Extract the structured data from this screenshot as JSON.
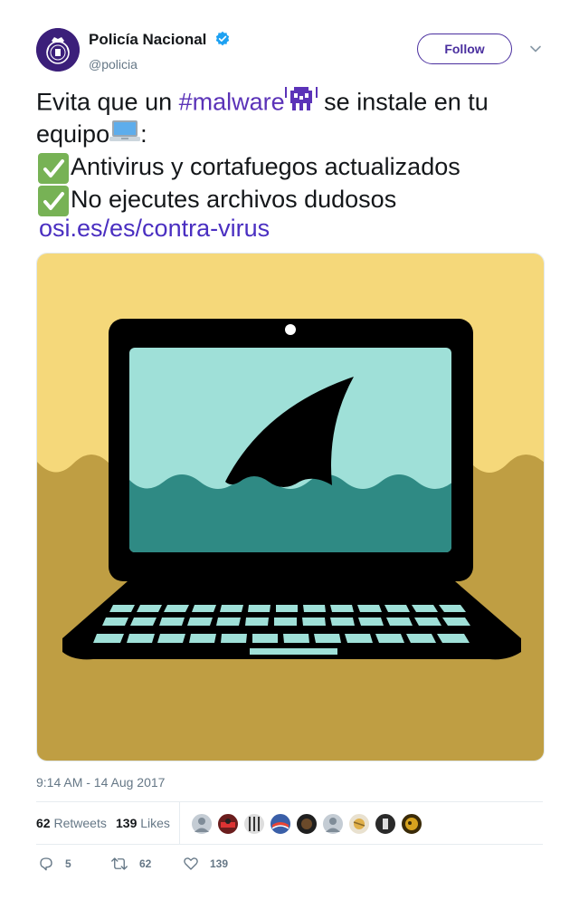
{
  "account": {
    "display_name": "Policía Nacional",
    "handle": "@policia",
    "verified": true,
    "avatar_icon": "police-crest-icon"
  },
  "follow_label": "Follow",
  "tweet": {
    "line1_before": "Evita que un ",
    "hashtag": "#malware",
    "line1_after": " se instale en tu",
    "line2": "equipo",
    "line2_after": ":",
    "check1": "Antivirus y cortafuegos actualizados",
    "check2": "No ejecutes archivos dudosos",
    "link": "osi.es/es/contra-virus"
  },
  "media": {
    "alt_icon": "laptop-shark-fin-illustration"
  },
  "timestamp": "9:14 AM - 14 Aug 2017",
  "stats": {
    "retweets_count": "62",
    "retweets_label": "Retweets",
    "likes_count": "139",
    "likes_label": "Likes"
  },
  "actions": {
    "replies": "5",
    "retweets": "62",
    "likes": "139"
  },
  "colors": {
    "brand_purple": "#4a2f9f",
    "hashtag": "#5b33b8",
    "link": "#4a2fc1",
    "verified_blue": "#1da1f2",
    "image_sky": "#f5d87a",
    "image_ground": "#bf9e43",
    "screen_water_light": "#9fe0d8",
    "screen_water_dark": "#2f8a84"
  }
}
